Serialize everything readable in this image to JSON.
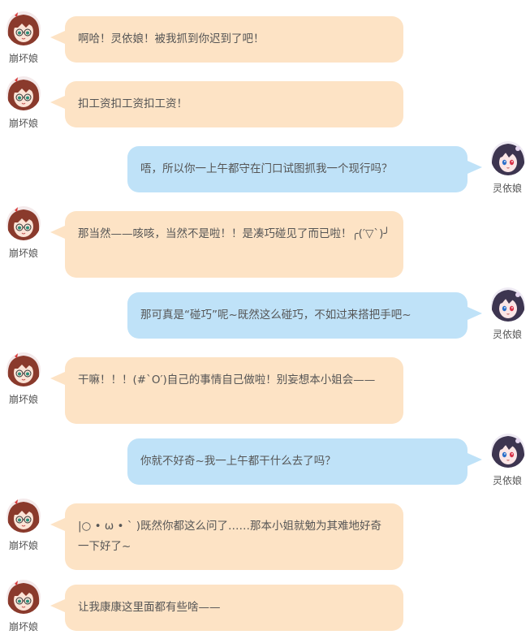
{
  "characters": {
    "left": {
      "name": "崩坏娘",
      "hair_color": "#8a3a2c",
      "skin_color": "#fbe3d6"
    },
    "right": {
      "name": "灵依娘",
      "hair_color": "#3d3550",
      "skin_color": "#fbe6e6"
    }
  },
  "colors": {
    "left_bubble": "#fde3c5",
    "right_bubble": "#bfe2f8",
    "text": "#555555"
  },
  "messages": [
    {
      "side": "left",
      "speaker": "崩坏娘",
      "text": "啊哈！灵依娘！被我抓到你迟到了吧！"
    },
    {
      "side": "left",
      "speaker": "崩坏娘",
      "text": "扣工资扣工资扣工资！"
    },
    {
      "side": "right",
      "speaker": "灵依娘",
      "text": "唔，所以你一上午都守在门口试图抓我一个现行吗？"
    },
    {
      "side": "left",
      "speaker": "崩坏娘",
      "text": "那当然——咳咳，当然不是啦！！是凑巧碰见了而已啦！╭(′▽`)╯"
    },
    {
      "side": "right",
      "speaker": "灵依娘",
      "text": "那可真是“碰巧”呢~既然这么碰巧，不如过来搭把手吧~"
    },
    {
      "side": "left",
      "speaker": "崩坏娘",
      "text": "干嘛！！！(#`O′)自己的事情自己做啦！别妄想本小姐会——"
    },
    {
      "side": "right",
      "speaker": "灵依娘",
      "text": "你就不好奇~我一上午都干什么去了吗？"
    },
    {
      "side": "left",
      "speaker": "崩坏娘",
      "text": "|○ • ω • ` )既然你都这么问了……那本小姐就勉为其难地好奇一下好了~"
    },
    {
      "side": "left",
      "speaker": "崩坏娘",
      "text": "让我康康这里面都有些啥——"
    }
  ]
}
